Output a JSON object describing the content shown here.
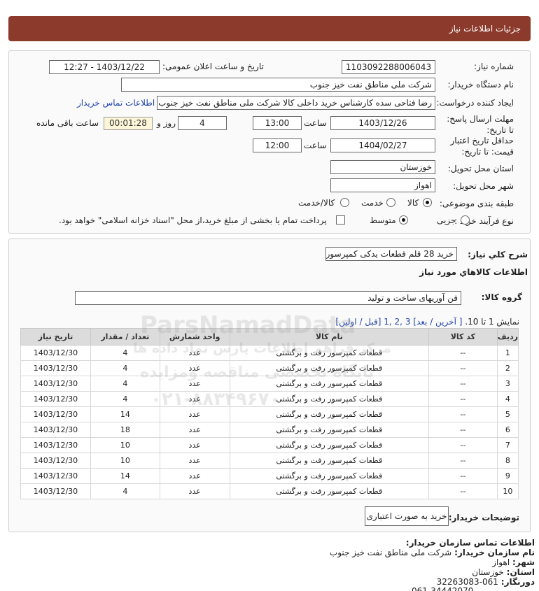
{
  "header": {
    "title": "جزئیات اطلاعات نیاز"
  },
  "form": {
    "need_number_label": "شماره نیاز:",
    "need_number": "1103092288006043",
    "announce_label": "تاریخ و ساعت اعلان عمومی:",
    "announce_value": "1403/12/22 - 12:27",
    "buyer_org_label": "نام دستگاه خریدار:",
    "buyer_org": "شرکت ملی مناطق نفت خیز جنوب",
    "creator_label": "ایجاد کننده درخواست:",
    "creator": "رضا فتاحی سده  کارشناس خرید داخلی کالا  شرکت ملی مناطق نفت خیز جنوب",
    "contact_link": "اطلاعات تماس خریدار",
    "deadline_label": "مهلت ارسال پاسخ: تا تاریخ:",
    "deadline_date": "1403/12/26",
    "time_label": "ساعت",
    "deadline_time": "13:00",
    "days_value": "4",
    "days_label": "روز و",
    "remaining_time": "00:01:28",
    "remaining_label": "ساعت باقی مانده",
    "validity_label": "حداقل تاریخ اعتبار قیمت: تا تاریخ:",
    "validity_date": "1404/02/27",
    "validity_time": "12:00",
    "province_label": "استان محل تحویل:",
    "province": "خوزستان",
    "city_label": "شهر محل تحویل:",
    "city": "اهواز",
    "category_label": "طبقه بندی موضوعی:",
    "category_options": [
      "کالا",
      "خدمت",
      "کالا/خدمت"
    ],
    "category_selected": "کالا",
    "process_label": "نوع فرآیند خرید :",
    "process_options": [
      "جزیی",
      "متوسط"
    ],
    "process_selected": "متوسط",
    "treasury_note": "پرداخت تمام یا بخشی از مبلغ خرید،از محل \"اسناد خزانه اسلامی\" خواهد بود."
  },
  "need": {
    "summary_label": "شرح کلي نياز:",
    "summary": "خرید 28 قلم قطعات یدکی کمپرسور",
    "goods_info_title": "اطلاعات کالاهاي مورد نياز",
    "group_label": "گروه کالا:",
    "group_value": "فن آوریهای ساخت و تولید",
    "pagination_text": "نمایش 1 تا 10.",
    "pagination_links": "[ آخرین / بعد] 3 ,2 ,1 [قبل / اولین]"
  },
  "table": {
    "headers": [
      "ردیف",
      "کد کالا",
      "نام کالا",
      "واحد شمارش",
      "تعداد / مقدار",
      "تاریخ نیاز"
    ],
    "rows": [
      [
        "1",
        "--",
        "قطعات کمپرسور رفت و برگشتی",
        "عدد",
        "4",
        "1403/12/30"
      ],
      [
        "2",
        "--",
        "قطعات کمپرسور رفت و برگشتی",
        "عدد",
        "4",
        "1403/12/30"
      ],
      [
        "3",
        "--",
        "قطعات کمپرسور رفت و برگشتی",
        "عدد",
        "4",
        "1403/12/30"
      ],
      [
        "4",
        "--",
        "قطعات کمپرسور رفت و برگشتی",
        "عدد",
        "4",
        "1403/12/30"
      ],
      [
        "5",
        "--",
        "قطعات کمپرسور رفت و برگشتی",
        "عدد",
        "14",
        "1403/12/30"
      ],
      [
        "6",
        "--",
        "قطعات کمپرسور رفت و برگشتی",
        "عدد",
        "18",
        "1403/12/30"
      ],
      [
        "7",
        "--",
        "قطعات کمپرسور رفت و برگشتی",
        "عدد",
        "10",
        "1403/12/30"
      ],
      [
        "8",
        "--",
        "قطعات کمپرسور رفت و برگشتی",
        "عدد",
        "10",
        "1403/12/30"
      ],
      [
        "9",
        "--",
        "قطعات کمپرسور رفت و برگشتی",
        "عدد",
        "14",
        "1403/12/30"
      ],
      [
        "10",
        "--",
        "قطعات کمپرسور رفت و برگشتی",
        "عدد",
        "4",
        "1403/12/30"
      ]
    ]
  },
  "buyer_notes": {
    "label": "توضیحات خریدار:",
    "value": "خرید به صورت اعتباری"
  },
  "contact": {
    "title": "اطلاعات تماس سازمان خریدار:",
    "org_label": "نام سازمان خریدار:",
    "org": "شرکت ملی مناطق نفت خیز جنوب",
    "city_label": "شهر:",
    "city": "اهواز",
    "province_label": "استان:",
    "province": "خوزستان",
    "fax_label": "دورنگار:",
    "fax": "061-32263083",
    "phone": "061-34442070"
  },
  "watermark": {
    "line1": "ParsNamadData",
    "line2": "مرکز فراهم اطلاعات پارس نماد داده ها",
    "line3": "پایگاه تخصصی مناقصه ومزایده",
    "line4": "۰۲۱-۸۸۳۴۹۶۷۰"
  }
}
